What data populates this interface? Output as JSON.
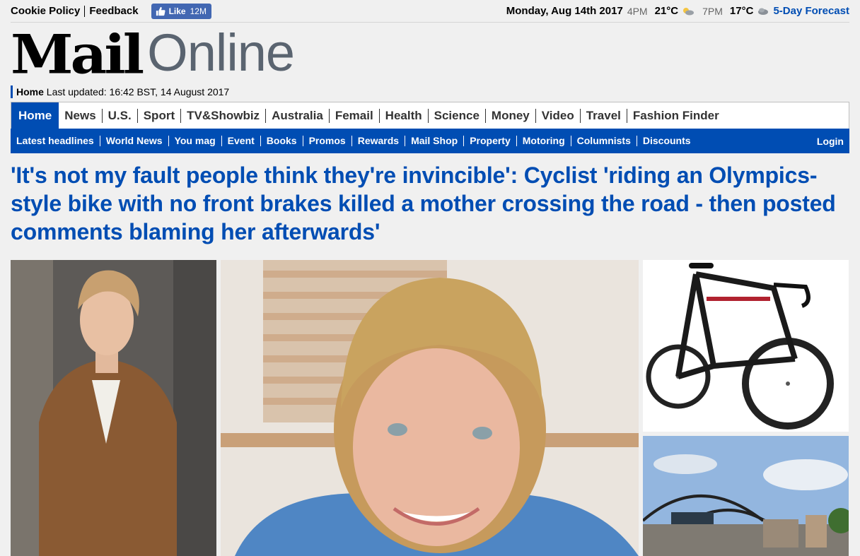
{
  "topbar": {
    "links": [
      "Cookie Policy",
      "Feedback"
    ],
    "fb_like": {
      "label": "Like",
      "count": "12M"
    }
  },
  "weather": {
    "date": "Monday, Aug 14th 2017",
    "slots": [
      {
        "time": "4PM",
        "temp": "21°C"
      },
      {
        "time": "7PM",
        "temp": "17°C"
      }
    ],
    "forecast_link": "5-Day Forecast"
  },
  "logo": {
    "mail": "Mail",
    "online": "Online"
  },
  "updated": {
    "section": "Home",
    "text": "Last updated: 16:42 BST, 14 August 2017"
  },
  "main_nav": {
    "active": "Home",
    "items": [
      "News",
      "U.S.",
      "Sport",
      "TV&Showbiz",
      "Australia",
      "Femail",
      "Health",
      "Science",
      "Money",
      "Video",
      "Travel",
      "Fashion Finder"
    ]
  },
  "sub_nav": {
    "items": [
      "Latest headlines",
      "World News",
      "You mag",
      "Event",
      "Books",
      "Promos",
      "Rewards",
      "Mail Shop",
      "Property",
      "Motoring",
      "Columnists",
      "Discounts"
    ],
    "login": "Login"
  },
  "article": {
    "headline": "'It's not my fault people think they're invincible': Cyclist 'riding an Olympics-style bike with no front brakes killed a mother crossing the road - then posted comments blaming her afterwards'"
  },
  "colors": {
    "brand_blue": "#004db3",
    "fb_blue": "#4267b2"
  }
}
